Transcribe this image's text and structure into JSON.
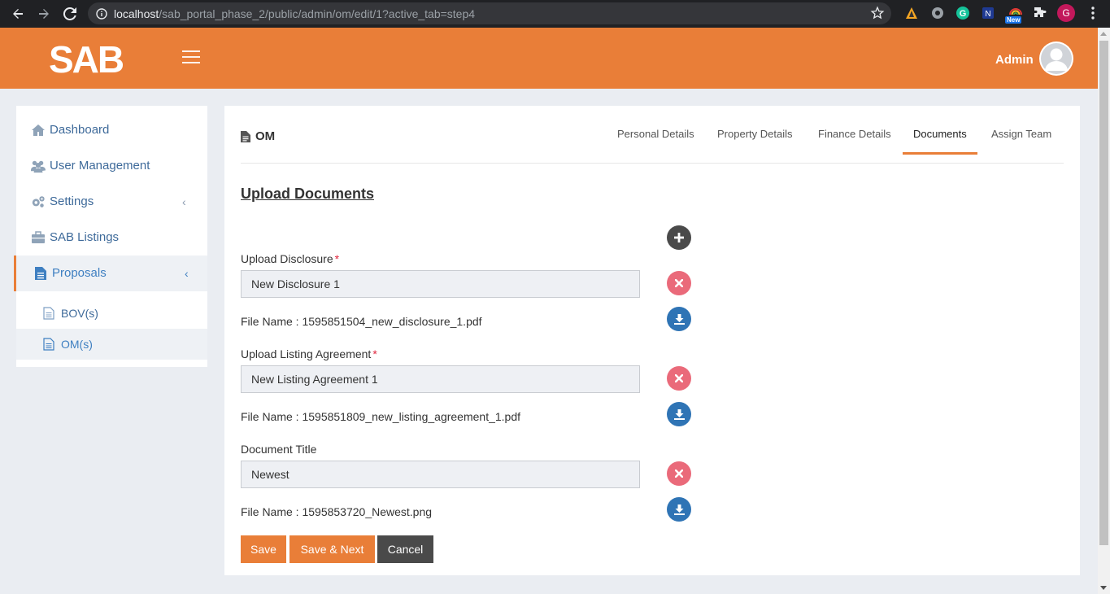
{
  "browser": {
    "url_host": "localhost",
    "url_path": "/sab_portal_phase_2/public/admin/om/edit/1?active_tab=step4",
    "extension_badge": "New",
    "profile_initial": "G"
  },
  "header": {
    "logo_text": "SAB",
    "user_name": "Admin",
    "accent_color": "#e97e38"
  },
  "sidebar": {
    "items": [
      {
        "label": "Dashboard",
        "icon": "home-icon"
      },
      {
        "label": "User Management",
        "icon": "users-icon"
      },
      {
        "label": "Settings",
        "icon": "cogs-icon"
      },
      {
        "label": "SAB Listings",
        "icon": "briefcase-icon"
      },
      {
        "label": "Proposals",
        "icon": "file-icon"
      }
    ],
    "subitems": [
      {
        "label": "BOV(s)",
        "icon": "document-icon"
      },
      {
        "label": "OM(s)",
        "icon": "document-icon"
      }
    ]
  },
  "panel": {
    "title": "OM",
    "tabs": [
      "Personal Details",
      "Property Details",
      "Finance Details",
      "Documents",
      "Assign Team"
    ],
    "active_tab": "Documents",
    "section_title": "Upload Documents",
    "documents": [
      {
        "label": "Upload Disclosure",
        "required": "*",
        "value": "New Disclosure 1",
        "file_name": "File Name : 1595851504_new_disclosure_1.pdf"
      },
      {
        "label": "Upload Listing Agreement",
        "required": "*",
        "value": "New Listing Agreement 1",
        "file_name": "File Name : 1595851809_new_listing_agreement_1.pdf"
      },
      {
        "label": "Document Title",
        "required": "",
        "value": "Newest",
        "file_name": "File Name : 1595853720_Newest.png"
      }
    ],
    "buttons": {
      "save": "Save",
      "save_next": "Save & Next",
      "cancel": "Cancel"
    }
  }
}
